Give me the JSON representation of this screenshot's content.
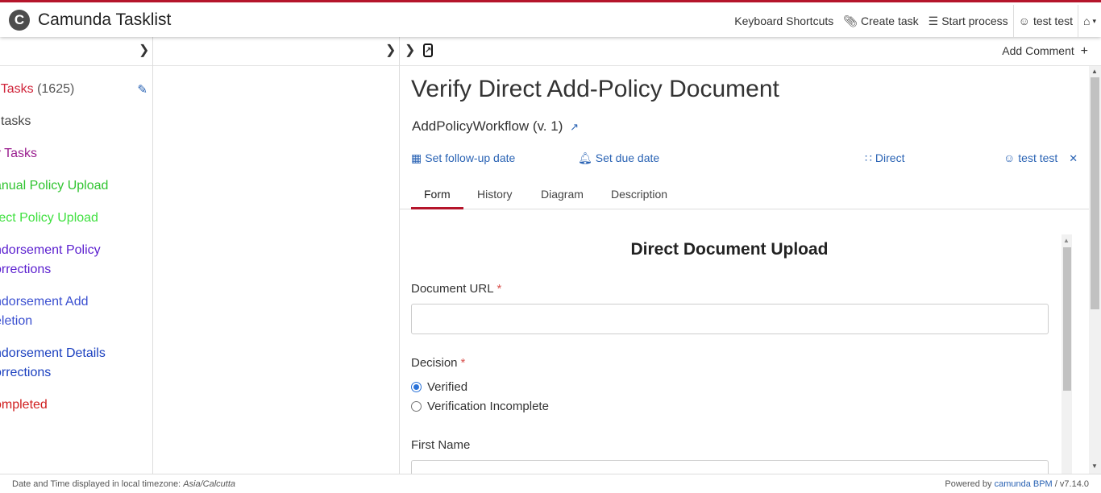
{
  "header": {
    "app_title": "Camunda Tasklist",
    "logo_letter": "C",
    "nav": {
      "keyboard_shortcuts": "Keyboard Shortcuts",
      "create_task": "Create task",
      "start_process": "Start process",
      "user": "test test"
    },
    "accent_color": "#b5152b"
  },
  "filters": [
    {
      "label": "l Tasks",
      "count": "(1625)",
      "color": "#d0243a"
    },
    {
      "label": "l tasks",
      "color": "#444444"
    },
    {
      "label": "y Tasks",
      "color": "#9a1e8f"
    },
    {
      "label": "anual Policy Upload",
      "color": "#2fc42f"
    },
    {
      "label": "rect Policy Upload",
      "color": "#3fe03f"
    },
    {
      "label": "ndorsement Policy",
      "label2": "orrections",
      "color": "#5a1ecf"
    },
    {
      "label": "ndorsement Add",
      "label2": "eletion",
      "color": "#3a4fd0"
    },
    {
      "label": "ndorsement Details",
      "label2": "orrections",
      "color": "#1a3fbf"
    },
    {
      "label": "ompleted",
      "color": "#d01e1e"
    }
  ],
  "task": {
    "add_comment": "Add Comment",
    "title": "Verify Direct Add-Policy Document",
    "process": "AddPolicyWorkflow (v. 1)",
    "follow_up": "Set follow-up date",
    "due_date": "Set due date",
    "group": "Direct",
    "assignee": "test test",
    "tabs": [
      "Form",
      "History",
      "Diagram",
      "Description"
    ],
    "active_tab": "Form"
  },
  "form": {
    "title": "Direct Document Upload",
    "document_url_label": "Document URL",
    "document_url_value": "",
    "required_mark": "*",
    "decision_label": "Decision",
    "decision_options": [
      "Verified",
      "Verification Incomplete"
    ],
    "decision_selected": "Verified",
    "first_name_label": "First Name",
    "first_name_value": ""
  },
  "footer": {
    "timezone_text": "Date and Time displayed in local timezone:",
    "timezone": "Asia/Calcutta",
    "powered_by": "Powered by",
    "powered_link": "camunda BPM",
    "version": "/ v7.14.0"
  }
}
